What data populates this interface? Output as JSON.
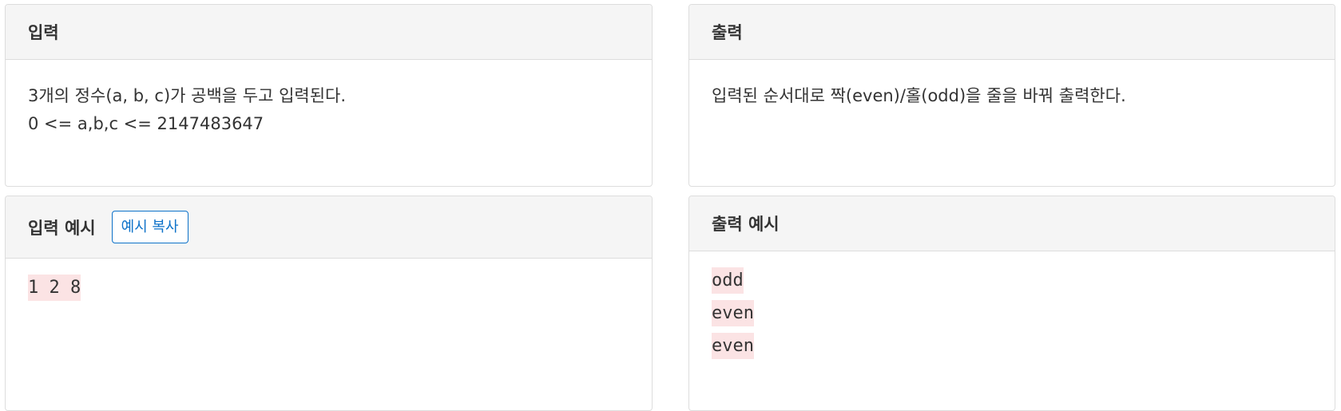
{
  "input_section": {
    "title": "입력",
    "lines": [
      "3개의 정수(a, b, c)가 공백을 두고 입력된다.",
      "0 <= a,b,c <= 2147483647"
    ]
  },
  "output_section": {
    "title": "출력",
    "lines": [
      "입력된 순서대로 짝(even)/홀(odd)을 줄을 바꿔 출력한다."
    ]
  },
  "sample_input": {
    "title": "입력 예시",
    "copy_label": "예시 복사",
    "lines": [
      "1 2 8"
    ]
  },
  "sample_output": {
    "title": "출력 예시",
    "lines": [
      "odd",
      "even",
      "even"
    ]
  },
  "colors": {
    "header_bg": "#f5f5f5",
    "border": "#dddddd",
    "accent": "#0d72c9",
    "sample_highlight": "#fbe3e4"
  }
}
